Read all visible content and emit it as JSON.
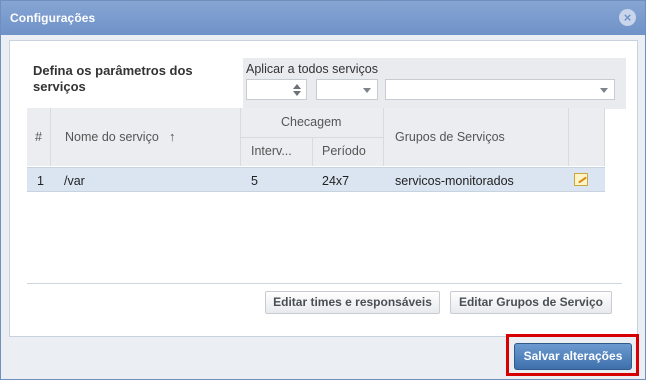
{
  "window": {
    "title": "Configurações",
    "close_label": "×"
  },
  "section": {
    "params_label": "Defina os parâmetros dos serviços",
    "apply_label": "Aplicar a todos serviços"
  },
  "table": {
    "columns": {
      "index": "#",
      "service_name": "Nome do serviço",
      "sort_arrow": "↑",
      "checagem": "Checagem",
      "intervalo": "Interv...",
      "periodo": "Período",
      "groups": "Grupos de Serviços"
    },
    "rows": [
      {
        "index": "1",
        "service_name": "/var",
        "intervalo": "5",
        "periodo": "24x7",
        "groups": "servicos-monitorados"
      }
    ]
  },
  "buttons": {
    "edit_teams": "Editar times e responsáveis",
    "edit_groups": "Editar Grupos de Serviço",
    "save": "Salvar alterações"
  },
  "colors": {
    "titlebar": "#7a9bcf",
    "save_button": "#4f7fbf",
    "highlight": "#d60000",
    "row_selected": "#dbe5f1"
  }
}
